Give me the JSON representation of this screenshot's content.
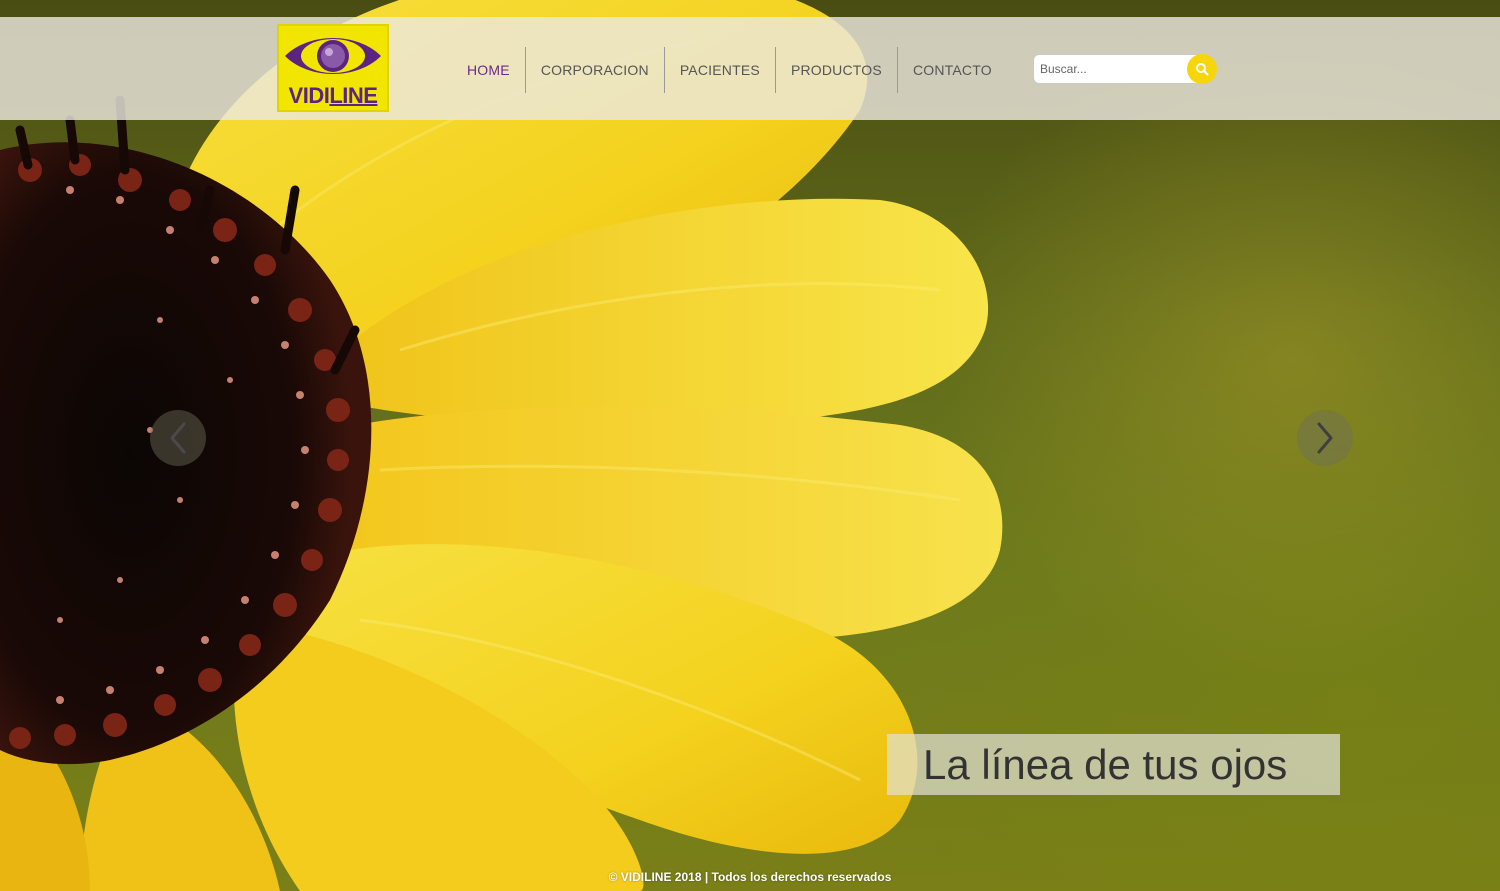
{
  "brand": {
    "name_part1": "VIDI",
    "name_part2": "LINE",
    "logo_color": "#f2e600",
    "brand_color": "#5b2480"
  },
  "nav": {
    "items": [
      {
        "label": "HOME",
        "active": true
      },
      {
        "label": "CORPORACION",
        "active": false
      },
      {
        "label": "PACIENTES",
        "active": false
      },
      {
        "label": "PRODUCTOS",
        "active": false
      },
      {
        "label": "CONTACTO",
        "active": false
      }
    ],
    "active_color": "#6b2a86"
  },
  "search": {
    "placeholder": "Buscar...",
    "value": "",
    "icon": "search-icon",
    "button_color": "#f6d60a"
  },
  "slider": {
    "prev_icon": "chevron-left-icon",
    "next_icon": "chevron-right-icon",
    "caption": "La línea de tus ojos"
  },
  "footer": {
    "text": "© VIDILINE 2018 | Todos los derechos reservados"
  }
}
